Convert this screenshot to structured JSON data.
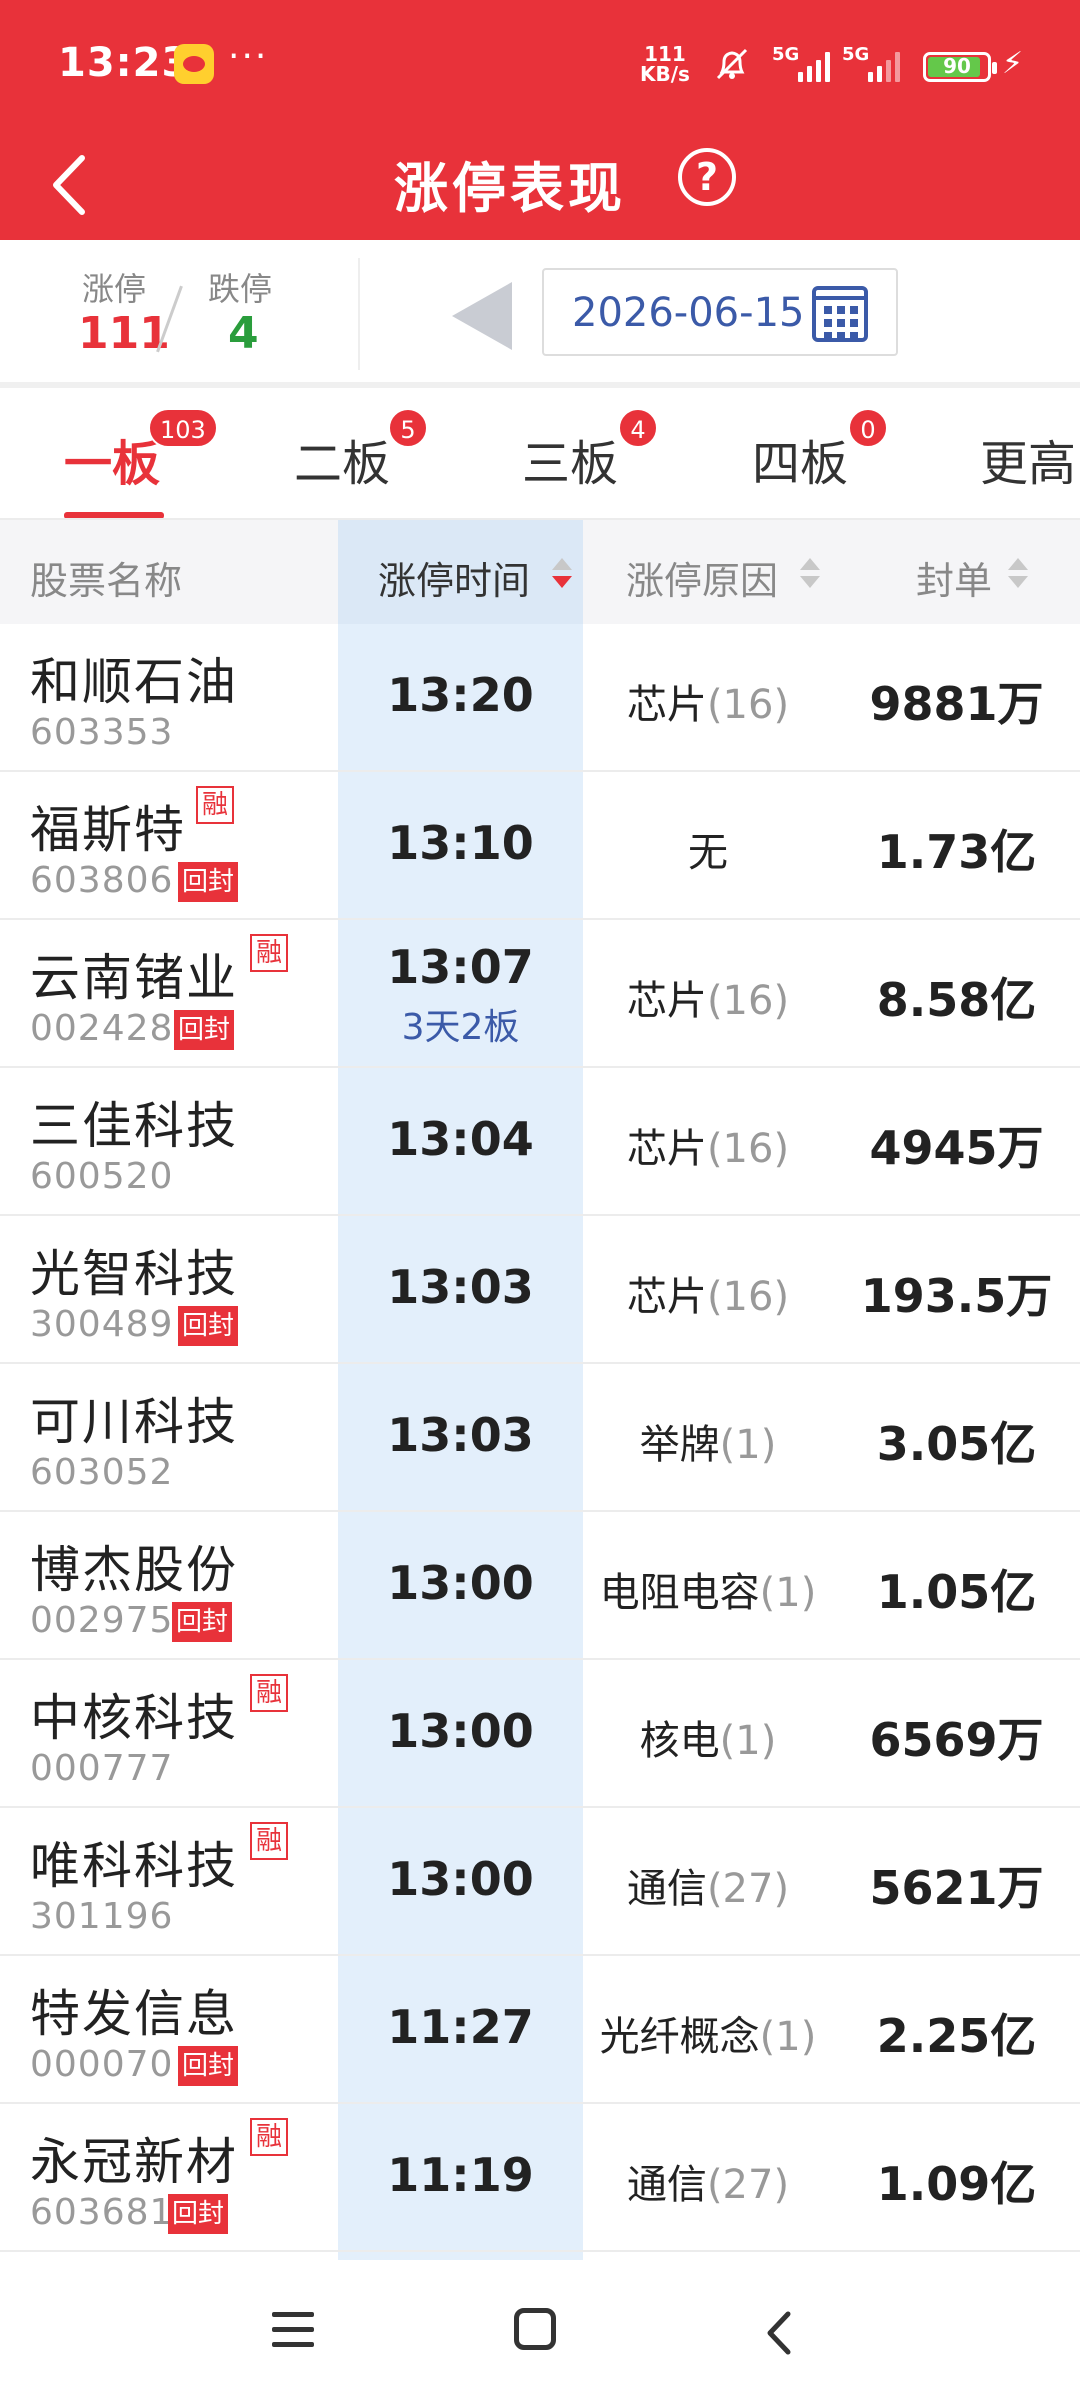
{
  "status_bar": {
    "time": "13:23",
    "dots": "···",
    "net_speed_value": "111",
    "net_speed_unit": "KB/s",
    "sig1": "5G",
    "sig2": "5G",
    "battery": "90",
    "battery_level": 0.9,
    "bolt": "⚡"
  },
  "header": {
    "title": "涨停表现",
    "help": "?"
  },
  "summary": {
    "up_label": "涨停",
    "up_value": "111",
    "down_label": "跌停",
    "down_value": "4",
    "date": "2026-06-15"
  },
  "tabs": [
    {
      "label": "一板",
      "badge": "103"
    },
    {
      "label": "二板",
      "badge": "5"
    },
    {
      "label": "三板",
      "badge": "4"
    },
    {
      "label": "四板",
      "badge": "0"
    },
    {
      "label": "更高",
      "badge": ""
    }
  ],
  "columns": {
    "name": "股票名称",
    "time": "涨停时间",
    "reason": "涨停原因",
    "seal": "封单"
  },
  "rows": [
    {
      "name": "和顺石油",
      "code": "603353",
      "rong": "",
      "hf": "",
      "time": "13:20",
      "sub": "",
      "reason": "芯片",
      "count": "(16)",
      "seal": "9881万"
    },
    {
      "name": "福斯特",
      "code": "603806",
      "rong": "融",
      "hf": "回封",
      "time": "13:10",
      "sub": "",
      "reason": "无",
      "count": "",
      "seal": "1.73亿"
    },
    {
      "name": "云南锗业",
      "code": "002428",
      "rong": "融",
      "hf": "回封",
      "time": "13:07",
      "sub": "3天2板",
      "reason": "芯片",
      "count": "(16)",
      "seal": "8.58亿"
    },
    {
      "name": "三佳科技",
      "code": "600520",
      "rong": "",
      "hf": "",
      "time": "13:04",
      "sub": "",
      "reason": "芯片",
      "count": "(16)",
      "seal": "4945万"
    },
    {
      "name": "光智科技",
      "code": "300489",
      "rong": "",
      "hf": "回封",
      "time": "13:03",
      "sub": "",
      "reason": "芯片",
      "count": "(16)",
      "seal": "193.5万"
    },
    {
      "name": "可川科技",
      "code": "603052",
      "rong": "",
      "hf": "",
      "time": "13:03",
      "sub": "",
      "reason": "举牌",
      "count": "(1)",
      "seal": "3.05亿"
    },
    {
      "name": "博杰股份",
      "code": "002975",
      "rong": "",
      "hf": "回封",
      "time": "13:00",
      "sub": "",
      "reason": "电阻电容",
      "count": "(1)",
      "seal": "1.05亿"
    },
    {
      "name": "中核科技",
      "code": "000777",
      "rong": "融",
      "hf": "",
      "time": "13:00",
      "sub": "",
      "reason": "核电",
      "count": "(1)",
      "seal": "6569万"
    },
    {
      "name": "唯科科技",
      "code": "301196",
      "rong": "融",
      "hf": "",
      "time": "13:00",
      "sub": "",
      "reason": "通信",
      "count": "(27)",
      "seal": "5621万"
    },
    {
      "name": "特发信息",
      "code": "000070",
      "rong": "",
      "hf": "回封",
      "time": "11:27",
      "sub": "",
      "reason": "光纤概念",
      "count": "(1)",
      "seal": "2.25亿"
    },
    {
      "name": "永冠新材",
      "code": "603681",
      "rong": "融",
      "hf": "回封",
      "time": "11:19",
      "sub": "",
      "reason": "通信",
      "count": "(27)",
      "seal": "1.09亿"
    }
  ]
}
